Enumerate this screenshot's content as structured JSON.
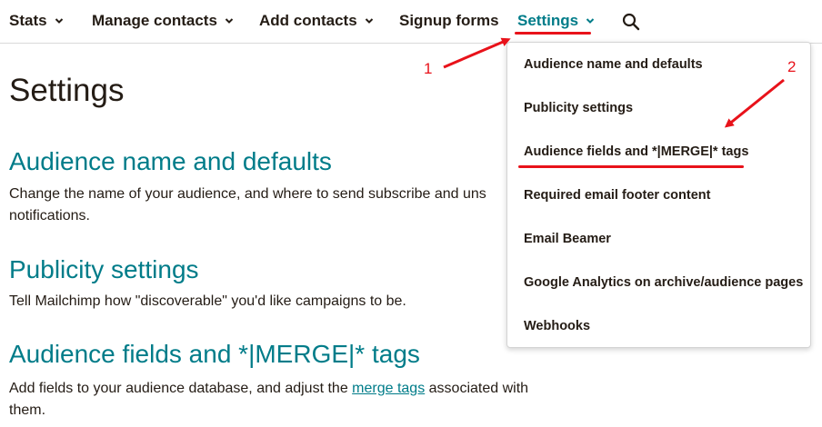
{
  "nav": {
    "stats": "Stats",
    "manage_contacts": "Manage contacts",
    "add_contacts": "Add contacts",
    "signup_forms": "Signup forms",
    "settings": "Settings"
  },
  "page": {
    "title": "Settings",
    "sections": [
      {
        "heading": "Audience name and defaults",
        "desc": "Change the name of your audience, and where to send subscribe and uns",
        "desc_line2": "notifications."
      },
      {
        "heading": "Publicity settings",
        "desc": "Tell Mailchimp how \"discoverable\" you'd like campaigns to be."
      },
      {
        "heading": "Audience fields and *|MERGE|* tags",
        "desc_pre": "Add fields to your audience database, and adjust the ",
        "desc_link": "merge tags",
        "desc_post": " associated with",
        "desc_line2": "them."
      }
    ]
  },
  "dropdown": {
    "items": [
      "Audience name and defaults",
      "Publicity settings",
      "Audience fields and *|MERGE|* tags",
      "Required email footer content",
      "Email Beamer",
      "Google Analytics on archive/audience pages",
      "Webhooks"
    ]
  },
  "annotations": {
    "one": "1",
    "two": "2"
  },
  "colors": {
    "accent": "#007c89",
    "annotation": "#e8121a"
  },
  "icons": {
    "search": "search-icon",
    "chevron": "chevron-down-icon"
  }
}
